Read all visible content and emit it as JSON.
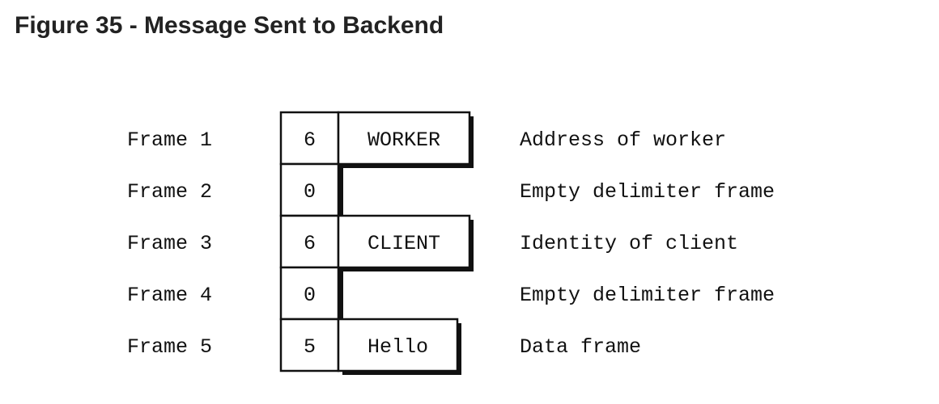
{
  "figure": {
    "title": "Figure 35 - Message Sent to Backend"
  },
  "frames": [
    {
      "label": "Frame 1",
      "size": "6",
      "content": "WORKER",
      "description": "Address of worker"
    },
    {
      "label": "Frame 2",
      "size": "0",
      "content": "",
      "description": "Empty delimiter frame"
    },
    {
      "label": "Frame 3",
      "size": "6",
      "content": "CLIENT",
      "description": "Identity of client"
    },
    {
      "label": "Frame 4",
      "size": "0",
      "content": "",
      "description": "Empty delimiter frame"
    },
    {
      "label": "Frame 5",
      "size": "5",
      "content": "Hello",
      "description": "Data frame"
    }
  ],
  "colors": {
    "line": "#111111",
    "shadow": "#111111",
    "title": "#222222"
  }
}
